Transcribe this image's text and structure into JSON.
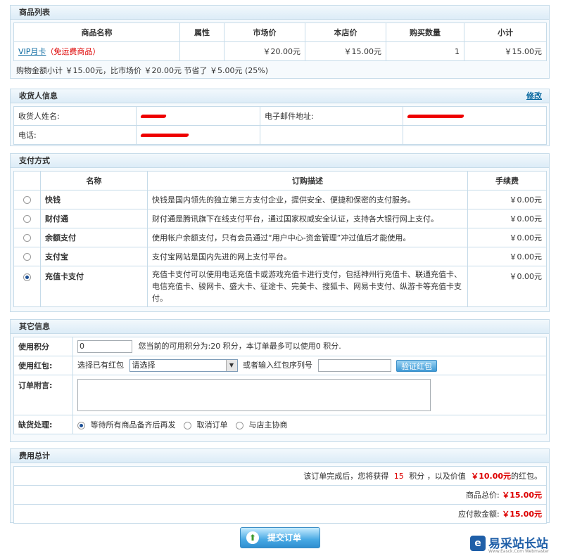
{
  "goods": {
    "title": "商品列表",
    "columns": [
      "商品名称",
      "属性",
      "市场价",
      "本店价",
      "购买数量",
      "小计"
    ],
    "item": {
      "name": "VIP月卡",
      "note": "（免运费商品）",
      "attr": "",
      "market_price": "￥20.00元",
      "shop_price": "￥15.00元",
      "qty": "1",
      "subtotal": "￥15.00元"
    },
    "summary": "购物金额小计 ￥15.00元，比市场价 ￥20.00元 节省了 ￥5.00元 (25%)"
  },
  "consignee": {
    "title": "收货人信息",
    "edit_label": "修改",
    "name_label": "收货人姓名:",
    "email_label": "电子邮件地址:",
    "phone_label": "电话:"
  },
  "payment": {
    "title": "支付方式",
    "columns": [
      "名称",
      "订购描述",
      "手续费"
    ],
    "methods": [
      {
        "name": "快钱",
        "desc": "快钱是国内领先的独立第三方支付企业，提供安全、便捷和保密的支付服务。",
        "fee": "￥0.00元",
        "selected": false
      },
      {
        "name": "财付通",
        "desc": "财付通是腾讯旗下在线支付平台，通过国家权威安全认证，支持各大银行网上支付。",
        "fee": "￥0.00元",
        "selected": false
      },
      {
        "name": "余额支付",
        "desc": "使用帐户余额支付，只有会员通过“用户中心-资金管理”冲过值后才能使用。",
        "fee": "￥0.00元",
        "selected": false
      },
      {
        "name": "支付宝",
        "desc": "支付宝网站是国内先进的网上支付平台。",
        "fee": "￥0.00元",
        "selected": false
      },
      {
        "name": "充值卡支付",
        "desc": "充值卡支付可以使用电话充值卡或游戏充值卡进行支付，包括神州行充值卡、联通充值卡、电信充值卡、骏网卡、盛大卡、征途卡、完美卡、搜狐卡、网易卡支付、纵游卡等充值卡支付。",
        "fee": "￥0.00元",
        "selected": true
      }
    ]
  },
  "other": {
    "title": "其它信息",
    "points_label": "使用积分",
    "points_value": "0",
    "points_hint": "您当前的可用积分为:20 积分，本订单最多可以使用0 积分.",
    "bonus_label": "使用红包:",
    "bonus_choose": "选择已有红包",
    "bonus_select": "请选择",
    "bonus_or": "或者输入红包序列号",
    "bonus_verify": "验证红包",
    "note_label": "订单附言:",
    "shortage_label": "缺货处理:",
    "shortage_options": [
      {
        "label": "等待所有商品备齐后再发",
        "selected": true
      },
      {
        "label": "取消订单",
        "selected": false
      },
      {
        "label": "与店主协商",
        "selected": false
      }
    ]
  },
  "total": {
    "title": "费用总计",
    "reward_pre": "该订单完成后，您将获得",
    "reward_points": "15",
    "reward_mid": "积分 ，以及价值",
    "reward_value": "￥10.00元",
    "reward_post": "的红包。",
    "goods_total_label": "商品总价:",
    "goods_total": "￥15.00元",
    "payable_label": "应付款金额:",
    "payable": "￥15.00元"
  },
  "submit_label": "提交订单",
  "watermark": {
    "text": "易采站长站",
    "sub": "Www.Easck.Com Webmaster"
  }
}
